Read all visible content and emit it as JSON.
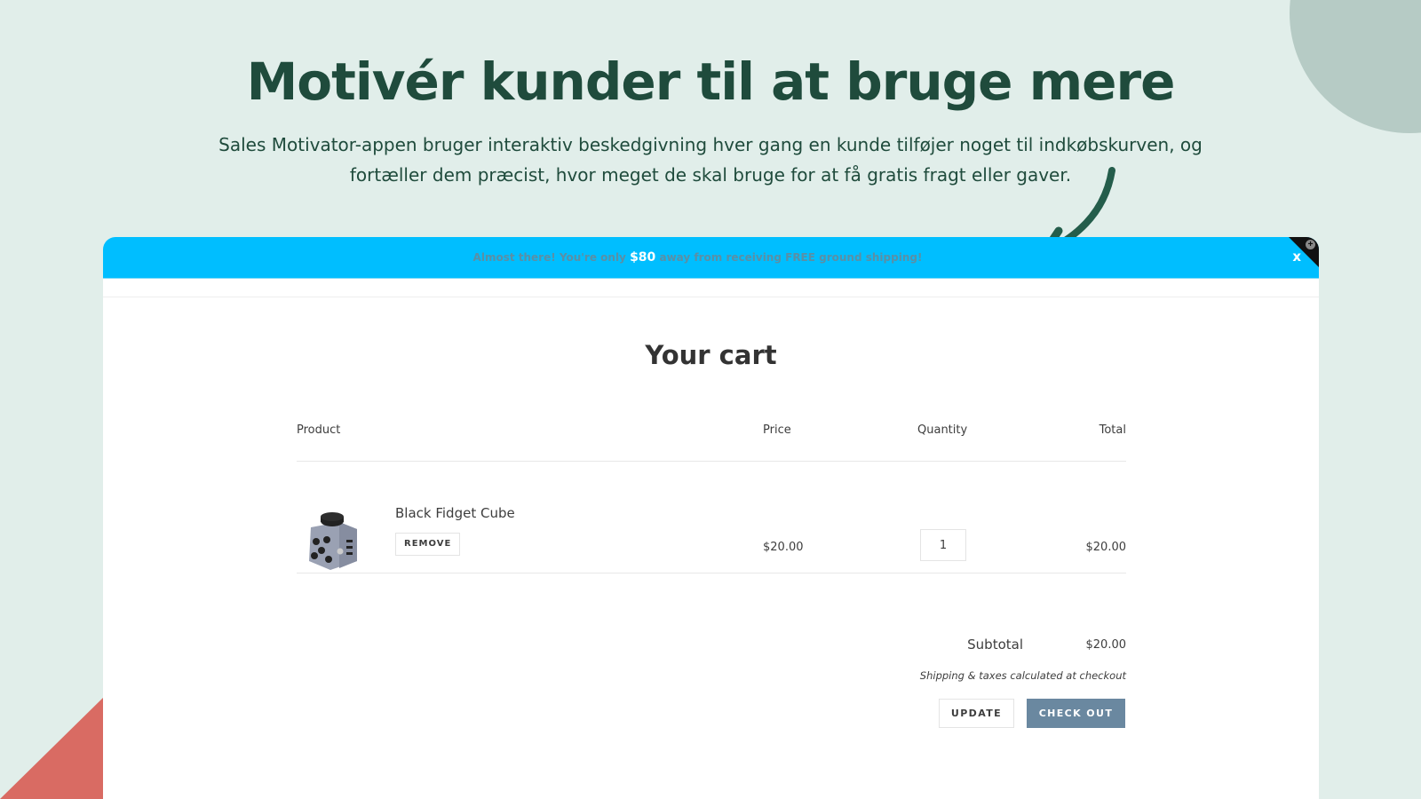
{
  "hero": {
    "headline": "Motivér kunder til at bruge mere",
    "subtext": "Sales Motivator-appen bruger interaktiv beskedgivning hver gang en kunde tilføjer noget til indkøbskurven, og fortæller dem præcist, hvor meget de skal bruge for at få gratis fragt eller gaver."
  },
  "motivator_bar": {
    "text_before": "Almost there! You're only ",
    "amount": "$80",
    "text_after": " away from receiving FREE ground shipping!",
    "close_label": "x",
    "background_color": "#00beff"
  },
  "cart": {
    "title": "Your cart",
    "columns": {
      "product": "Product",
      "price": "Price",
      "quantity": "Quantity",
      "total": "Total"
    },
    "items": [
      {
        "name": "Black Fidget Cube",
        "remove_label": "REMOVE",
        "price": "$20.00",
        "quantity": "1",
        "total": "$20.00"
      }
    ],
    "subtotal_label": "Subtotal",
    "subtotal_value": "$20.00",
    "shipping_note": "Shipping & taxes calculated at checkout",
    "update_label": "UPDATE",
    "checkout_label": "CHECK OUT",
    "checkout_color": "#6a88a0"
  }
}
